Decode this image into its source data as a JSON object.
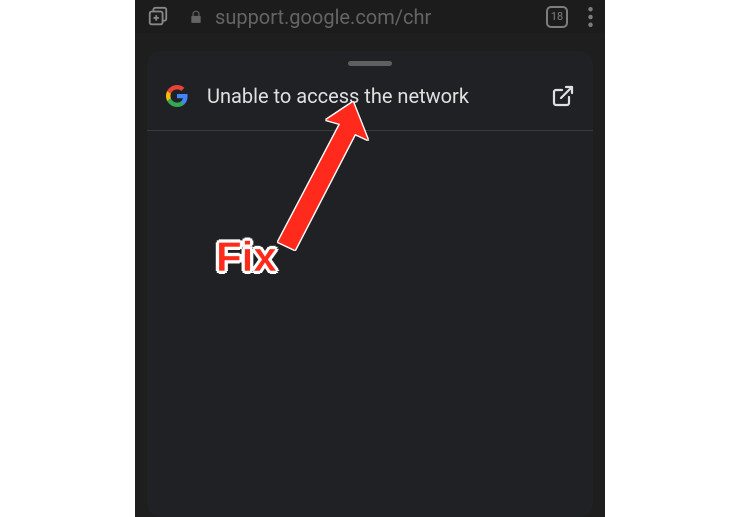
{
  "topbar": {
    "url": "support.google.com/chr",
    "tab_count": "18"
  },
  "panel": {
    "error_message": "Unable to access the network"
  },
  "annotation": {
    "label": "Fix"
  }
}
